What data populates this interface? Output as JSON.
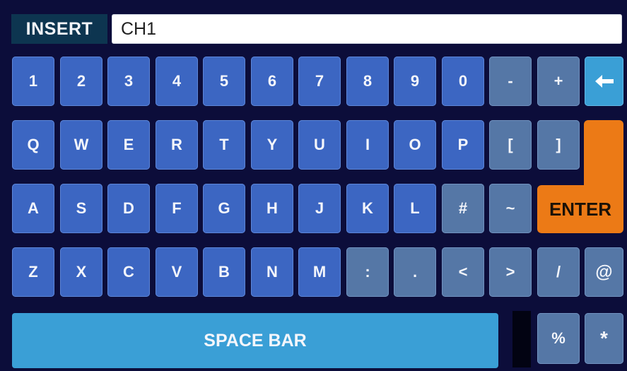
{
  "header": {
    "mode_label": "INSERT",
    "input_value": "CH1"
  },
  "rows": {
    "numbers": [
      "1",
      "2",
      "3",
      "4",
      "5",
      "6",
      "7",
      "8",
      "9",
      "0",
      "-",
      "+"
    ],
    "qwerty": [
      "Q",
      "W",
      "E",
      "R",
      "T",
      "Y",
      "U",
      "I",
      "O",
      "P",
      "[",
      "]"
    ],
    "asdf": [
      "A",
      "S",
      "D",
      "F",
      "G",
      "H",
      "J",
      "K",
      "L",
      "#",
      "~"
    ],
    "zxcv": [
      "Z",
      "X",
      "C",
      "V",
      "B",
      "N",
      "M",
      ":",
      ".",
      "<",
      ">",
      "/",
      "@"
    ]
  },
  "keys": {
    "backspace_icon": "left-arrow-icon",
    "enter_label": "ENTER",
    "space_label": "SPACE BAR",
    "percent_label": "%",
    "asterisk_label": "*"
  },
  "colors": {
    "background": "#0c0d3a",
    "key_blue": "#3c66c2",
    "key_gray": "#5577a6",
    "key_cyan": "#3a9fd6",
    "enter_orange": "#ec7a16"
  }
}
